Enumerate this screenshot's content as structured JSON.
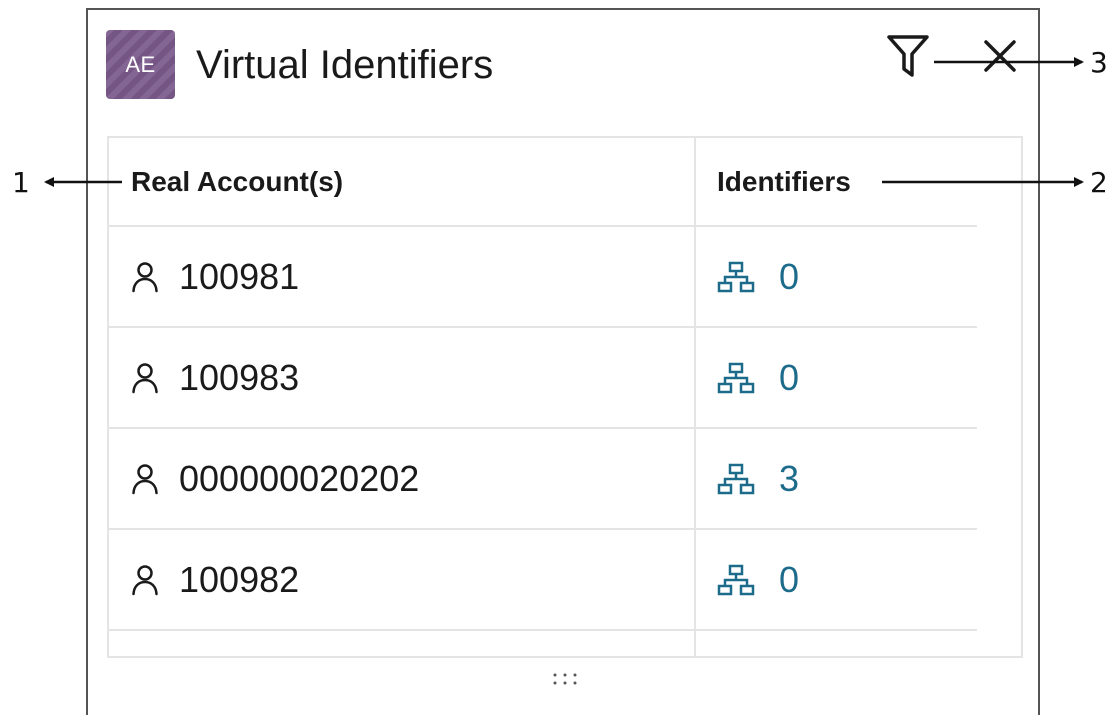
{
  "window": {
    "badge_initials": "AE",
    "title": "Virtual Identifiers",
    "badge_color": "#7b5a8c"
  },
  "toolbar": {
    "filter_icon": "filter-icon",
    "close_icon": "close-icon"
  },
  "table": {
    "headers": {
      "account": "Real Account(s)",
      "identifiers": "Identifiers"
    },
    "rows": [
      {
        "account": "100981",
        "identifiers": "0"
      },
      {
        "account": "100983",
        "identifiers": "0"
      },
      {
        "account": "000000020202",
        "identifiers": "3"
      },
      {
        "account": "100982",
        "identifiers": "0"
      }
    ],
    "account_icon": "user-icon",
    "identifier_icon": "hierarchy-icon",
    "link_color": "#1d6b8a"
  },
  "callouts": {
    "one": "1",
    "two": "2",
    "three": "3"
  }
}
